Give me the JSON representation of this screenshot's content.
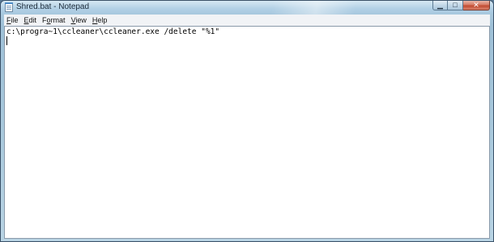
{
  "window": {
    "title": "Shred.bat - Notepad",
    "icon": "notepad-icon"
  },
  "caption_buttons": {
    "minimize": "▁",
    "maximize": "□",
    "close": "✕"
  },
  "menu": {
    "items": [
      {
        "accel": "F",
        "rest": "ile"
      },
      {
        "accel": "E",
        "rest": "dit"
      },
      {
        "accel": "F",
        "rest": "ormat",
        "prefix": "F",
        "accel_alt": "o"
      },
      {
        "accel": "V",
        "rest": "iew"
      },
      {
        "accel": "H",
        "rest": "elp"
      }
    ]
  },
  "editor": {
    "content": "c:\\progra~1\\ccleaner\\ccleaner.exe /delete \"%1\""
  },
  "colors": {
    "titlebar": "#b3d1e6",
    "close_button": "#c04a30",
    "editor_bg": "#ffffff"
  }
}
